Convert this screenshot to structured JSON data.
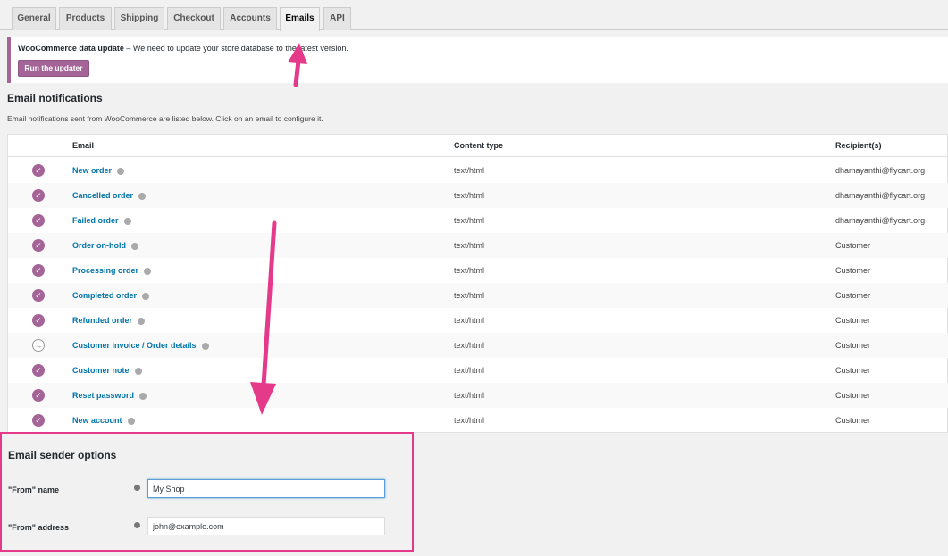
{
  "tabs": [
    "General",
    "Products",
    "Shipping",
    "Checkout",
    "Accounts",
    "Emails",
    "API"
  ],
  "active_tab": "Emails",
  "notice": {
    "title": "WooCommerce data update",
    "text": " – We need to update your store database to the latest version.",
    "button": "Run the updater"
  },
  "email_notifications": {
    "heading": "Email notifications",
    "description": "Email notifications sent from WooCommerce are listed below. Click on an email to configure it.",
    "columns": [
      "Email",
      "Content type",
      "Recipient(s)"
    ],
    "rows": [
      {
        "name": "New order",
        "content_type": "text/html",
        "recipient": "dhamayanthi@flycart.org",
        "status": "enabled"
      },
      {
        "name": "Cancelled order",
        "content_type": "text/html",
        "recipient": "dhamayanthi@flycart.org",
        "status": "enabled"
      },
      {
        "name": "Failed order",
        "content_type": "text/html",
        "recipient": "dhamayanthi@flycart.org",
        "status": "enabled"
      },
      {
        "name": "Order on-hold",
        "content_type": "text/html",
        "recipient": "Customer",
        "status": "enabled"
      },
      {
        "name": "Processing order",
        "content_type": "text/html",
        "recipient": "Customer",
        "status": "enabled"
      },
      {
        "name": "Completed order",
        "content_type": "text/html",
        "recipient": "Customer",
        "status": "enabled"
      },
      {
        "name": "Refunded order",
        "content_type": "text/html",
        "recipient": "Customer",
        "status": "enabled"
      },
      {
        "name": "Customer invoice / Order details",
        "content_type": "text/html",
        "recipient": "Customer",
        "status": "manual"
      },
      {
        "name": "Customer note",
        "content_type": "text/html",
        "recipient": "Customer",
        "status": "enabled"
      },
      {
        "name": "Reset password",
        "content_type": "text/html",
        "recipient": "Customer",
        "status": "enabled"
      },
      {
        "name": "New account",
        "content_type": "text/html",
        "recipient": "Customer",
        "status": "enabled"
      }
    ]
  },
  "sender_options": {
    "heading": "Email sender options",
    "from_name_label": "\"From\" name",
    "from_name_value": "My Shop",
    "from_address_label": "\"From\" address",
    "from_address_value": "john@example.com"
  },
  "colors": {
    "accent": "#a46497",
    "link": "#0073aa",
    "highlight": "#e5398a"
  },
  "icons": {
    "enabled": "check-circle-icon",
    "manual": "arrow-circle-icon",
    "help": "help-tip-icon"
  }
}
